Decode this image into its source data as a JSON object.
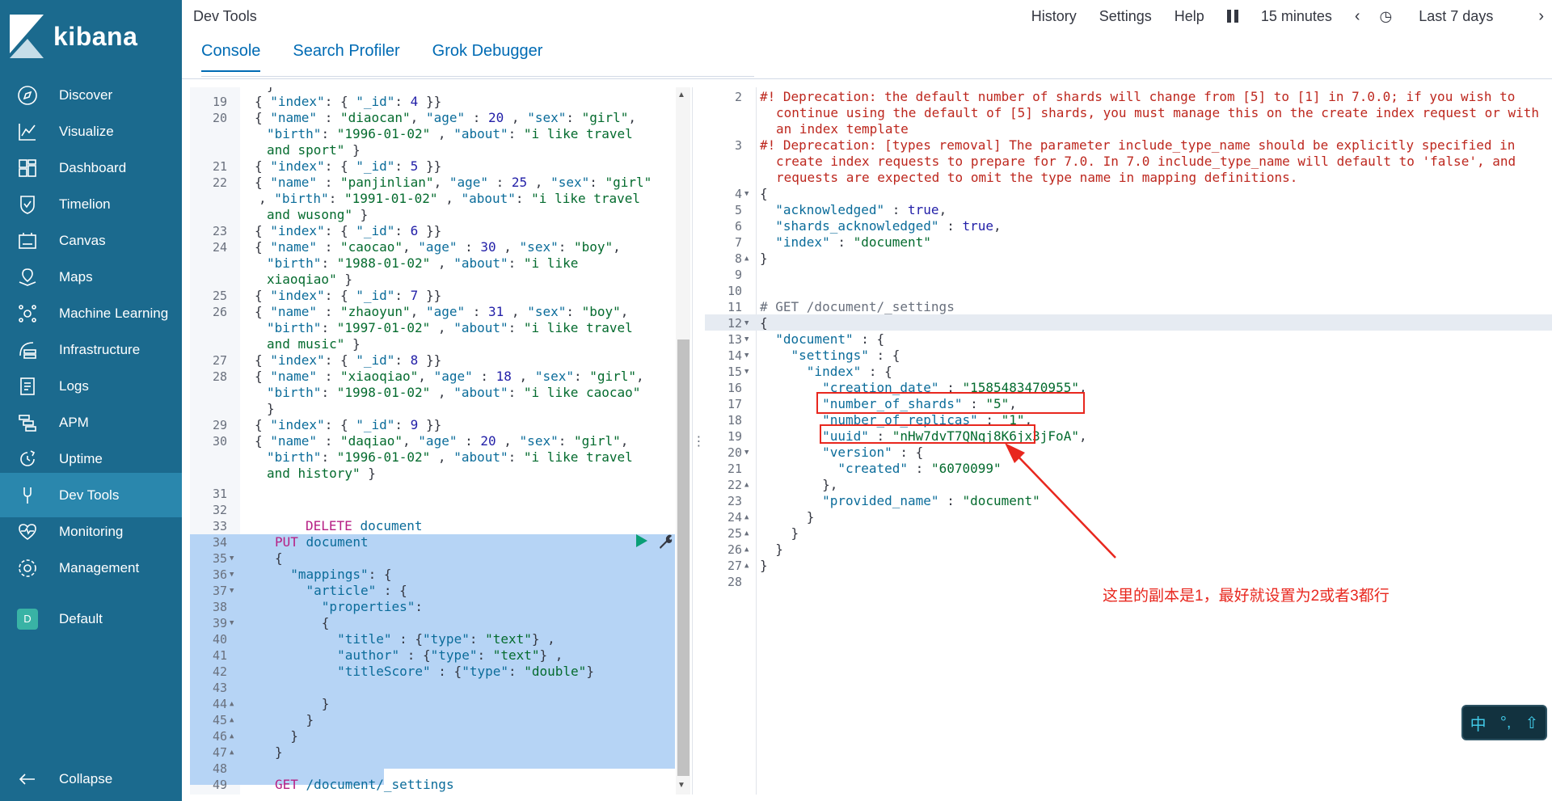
{
  "brand": {
    "name": "kibana"
  },
  "sidebar": {
    "items": [
      {
        "label": "Discover",
        "icon": "compass-icon"
      },
      {
        "label": "Visualize",
        "icon": "chart-icon"
      },
      {
        "label": "Dashboard",
        "icon": "dashboard-icon"
      },
      {
        "label": "Timelion",
        "icon": "shield-icon"
      },
      {
        "label": "Canvas",
        "icon": "canvas-icon"
      },
      {
        "label": "Maps",
        "icon": "map-icon"
      },
      {
        "label": "Machine Learning",
        "icon": "ml-icon"
      },
      {
        "label": "Infrastructure",
        "icon": "infra-icon"
      },
      {
        "label": "Logs",
        "icon": "logs-icon"
      },
      {
        "label": "APM",
        "icon": "apm-icon"
      },
      {
        "label": "Uptime",
        "icon": "uptime-icon"
      },
      {
        "label": "Dev Tools",
        "icon": "devtools-icon"
      },
      {
        "label": "Monitoring",
        "icon": "monitoring-icon"
      },
      {
        "label": "Management",
        "icon": "gear-icon"
      }
    ],
    "space": {
      "badge": "D",
      "label": "Default"
    },
    "collapse_label": "Collapse",
    "active_color": "#2a87ad"
  },
  "header": {
    "title": "Dev Tools",
    "history": "History",
    "settings": "Settings",
    "help": "Help",
    "refresh_interval": "15 minutes",
    "time_range": "Last 7 days"
  },
  "tabs": [
    "Console",
    "Search Profiler",
    "Grok Debugger"
  ],
  "annotation": {
    "note": "这里的副本是1，最好就设置为2或者3都行"
  },
  "ime": {
    "mode": "中",
    "punct": "°,",
    "shift": "⇧"
  }
}
